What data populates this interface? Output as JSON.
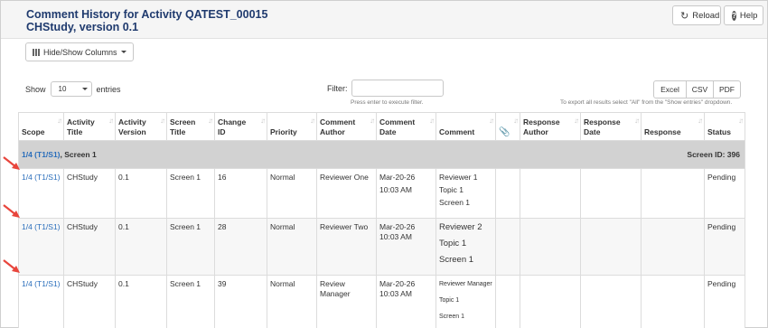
{
  "header": {
    "title_line1": "Comment History for Activity QATEST_00015",
    "title_line2": "CHStudy, version 0.1",
    "reload_label": "Reload",
    "help_label": "Help"
  },
  "toolbar": {
    "hide_show_label": "Hide/Show Columns"
  },
  "length_control": {
    "show_label": "Show",
    "value": "10",
    "entries_label": "entries"
  },
  "filter": {
    "label": "Filter:",
    "value": "",
    "hint": "Press enter to execute filter."
  },
  "export": {
    "buttons": [
      "Excel",
      "CSV",
      "PDF"
    ],
    "hint": "To export all results select \"All\" from the \"Show entries\" dropdown."
  },
  "table": {
    "columns": [
      {
        "label_1": "Scope",
        "label_2": ""
      },
      {
        "label_1": "Activity",
        "label_2": "Title"
      },
      {
        "label_1": "Activity",
        "label_2": "Version"
      },
      {
        "label_1": "Screen",
        "label_2": "Title"
      },
      {
        "label_1": "Change",
        "label_2": "ID"
      },
      {
        "label_1": "Priority",
        "label_2": ""
      },
      {
        "label_1": "Comment",
        "label_2": "Author"
      },
      {
        "label_1": "Comment",
        "label_2": "Date"
      },
      {
        "label_1": "Comment",
        "label_2": ""
      },
      {
        "label_1": "",
        "label_2": ""
      },
      {
        "label_1": "Response",
        "label_2": "Author"
      },
      {
        "label_1": "Response",
        "label_2": "Date"
      },
      {
        "label_1": "Response",
        "label_2": ""
      },
      {
        "label_1": "Status",
        "label_2": ""
      }
    ],
    "group": {
      "scope_link": "1/4 (T1/S1)",
      "screen": ", Screen 1",
      "screen_id": "Screen ID: 396"
    },
    "rows": [
      {
        "scope": "1/4 (T1/S1)",
        "activity_title": "CHStudy",
        "activity_version": "0.1",
        "screen_title": "Screen 1",
        "change_id": "16",
        "priority": "Normal",
        "comment_author": "Reviewer One",
        "comment_date_1": "Mar-20-26",
        "comment_date_2": "10:03 AM",
        "comment_lines": [
          "Reviewer 1",
          "Topic 1",
          "Screen 1"
        ],
        "response_author": "",
        "response_date": "",
        "response": "",
        "status": "Pending"
      },
      {
        "scope": "1/4 (T1/S1)",
        "activity_title": "CHStudy",
        "activity_version": "0.1",
        "screen_title": "Screen 1",
        "change_id": "28",
        "priority": "Normal",
        "comment_author": "Reviewer Two",
        "comment_date_1": "Mar-20-26",
        "comment_date_2": "10:03 AM",
        "comment_lines": [
          "Reviewer 2",
          "Topic 1",
          "Screen 1"
        ],
        "response_author": "",
        "response_date": "",
        "response": "",
        "status": "Pending"
      },
      {
        "scope": "1/4 (T1/S1)",
        "activity_title": "CHStudy",
        "activity_version": "0.1",
        "screen_title": "Screen 1",
        "change_id": "39",
        "priority": "Normal",
        "comment_author": "Review Manager",
        "comment_date_1": "Mar-20-26",
        "comment_date_2": "10:03 AM",
        "comment_lines": [
          "Reviewer Manager",
          "Topic 1",
          "Screen 1"
        ],
        "response_author": "",
        "response_date": "",
        "response": "",
        "status": "Pending"
      }
    ]
  },
  "colors": {
    "title": "#1f3a6e",
    "link": "#2a6ebb",
    "group_row": "#d2d2d2",
    "annotation_arrow": "#e8453c"
  },
  "icons": {
    "reload": "reload-icon",
    "help": "help-icon",
    "columns": "columns-icon",
    "attachment": "paperclip-icon",
    "sort": "sort-icon",
    "annotation": "red-arrow-icon"
  }
}
